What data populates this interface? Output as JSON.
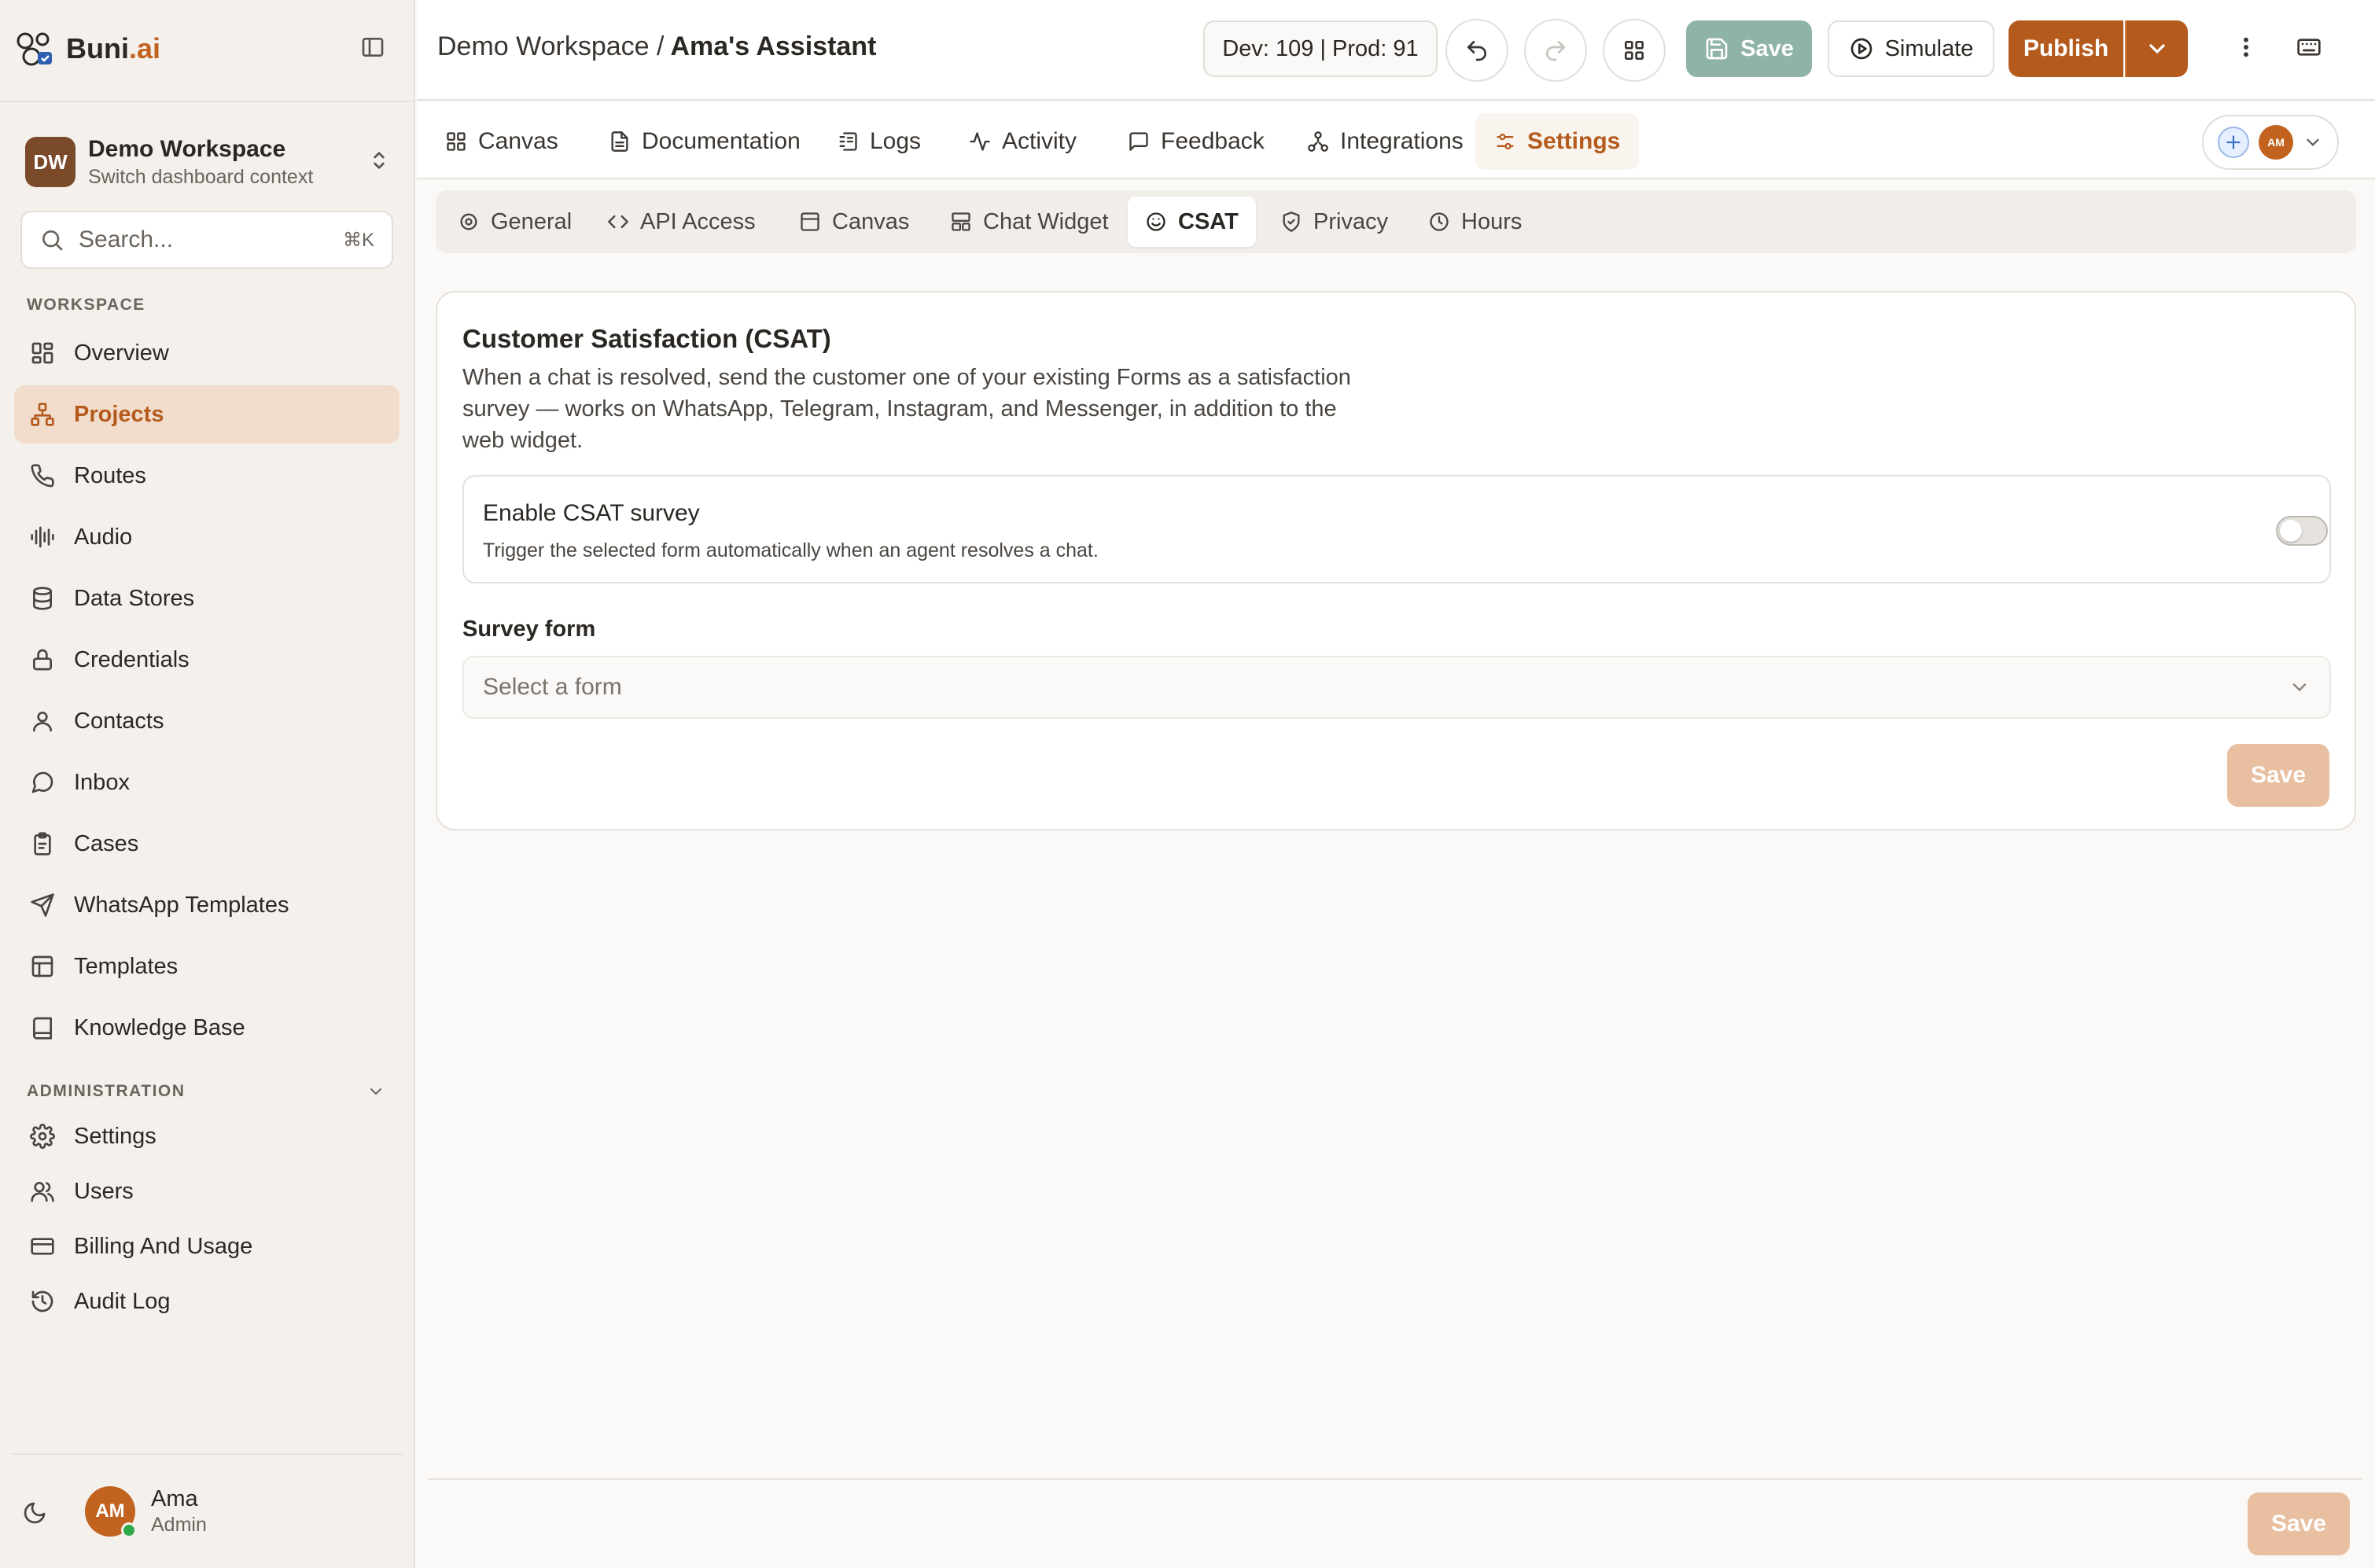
{
  "brand": {
    "name_prefix": "Buni",
    "name_suffix": ".ai"
  },
  "workspace_switcher": {
    "initials": "DW",
    "name": "Demo Workspace",
    "subtitle": "Switch dashboard context"
  },
  "search": {
    "placeholder": "Search...",
    "shortcut": "⌘K"
  },
  "sidebar": {
    "workspace_label": "WORKSPACE",
    "items": [
      {
        "label": "Overview",
        "icon": "grid-icon"
      },
      {
        "label": "Projects",
        "icon": "projects-icon",
        "active": true
      },
      {
        "label": "Routes",
        "icon": "phone-icon"
      },
      {
        "label": "Audio",
        "icon": "audio-wave-icon"
      },
      {
        "label": "Data Stores",
        "icon": "database-icon"
      },
      {
        "label": "Credentials",
        "icon": "lock-icon"
      },
      {
        "label": "Contacts",
        "icon": "user-icon"
      },
      {
        "label": "Inbox",
        "icon": "chat-bubble-icon"
      },
      {
        "label": "Cases",
        "icon": "clipboard-icon"
      },
      {
        "label": "WhatsApp Templates",
        "icon": "send-icon"
      },
      {
        "label": "Templates",
        "icon": "layout-icon"
      },
      {
        "label": "Knowledge Base",
        "icon": "book-icon"
      }
    ],
    "admin_label": "ADMINISTRATION",
    "admin_items": [
      {
        "label": "Settings",
        "icon": "gear-icon"
      },
      {
        "label": "Users",
        "icon": "users-icon"
      },
      {
        "label": "Billing And Usage",
        "icon": "credit-card-icon"
      },
      {
        "label": "Audit Log",
        "icon": "history-icon"
      }
    ]
  },
  "user": {
    "initials": "AM",
    "name": "Ama",
    "role": "Admin"
  },
  "topbar": {
    "breadcrumb_workspace": "Demo Workspace /",
    "breadcrumb_current": "Ama's Assistant",
    "version": "Dev: 109 | Prod: 91",
    "save_label": "Save",
    "simulate_label": "Simulate",
    "publish_label": "Publish"
  },
  "tabs": [
    {
      "label": "Canvas",
      "icon": "canvas-icon"
    },
    {
      "label": "Documentation",
      "icon": "document-icon"
    },
    {
      "label": "Logs",
      "icon": "logs-icon"
    },
    {
      "label": "Activity",
      "icon": "activity-icon"
    },
    {
      "label": "Feedback",
      "icon": "message-square-icon"
    },
    {
      "label": "Integrations",
      "icon": "integrations-icon"
    },
    {
      "label": "Settings",
      "icon": "sliders-icon",
      "active": true
    }
  ],
  "tab_right": {
    "avatar_initials": "AM"
  },
  "settings_tabs": [
    {
      "label": "General",
      "icon": "gear-icon"
    },
    {
      "label": "API Access",
      "icon": "code-icon"
    },
    {
      "label": "Canvas",
      "icon": "canvas-icon"
    },
    {
      "label": "Chat Widget",
      "icon": "widget-icon"
    },
    {
      "label": "CSAT",
      "icon": "smile-icon",
      "active": true
    },
    {
      "label": "Privacy",
      "icon": "shield-check-icon"
    },
    {
      "label": "Hours",
      "icon": "clock-icon"
    }
  ],
  "csat": {
    "title": "Customer Satisfaction (CSAT)",
    "description": "When a chat is resolved, send the customer one of your existing Forms as a satisfaction survey — works on WhatsApp, Telegram, Instagram, and Messenger, in addition to the web widget.",
    "toggle_title": "Enable CSAT survey",
    "toggle_hint": "Trigger the selected form automatically when an agent resolves a chat.",
    "toggle_enabled": false,
    "survey_form_label": "Survey form",
    "survey_form_placeholder": "Select a form",
    "save_label": "Save"
  },
  "footer": {
    "save_label": "Save"
  },
  "colors": {
    "accent": "#b35a1c",
    "active_bg": "#f2dccb",
    "save_disabled": "#e8bfa0",
    "save_top": "#8fb3a4"
  }
}
